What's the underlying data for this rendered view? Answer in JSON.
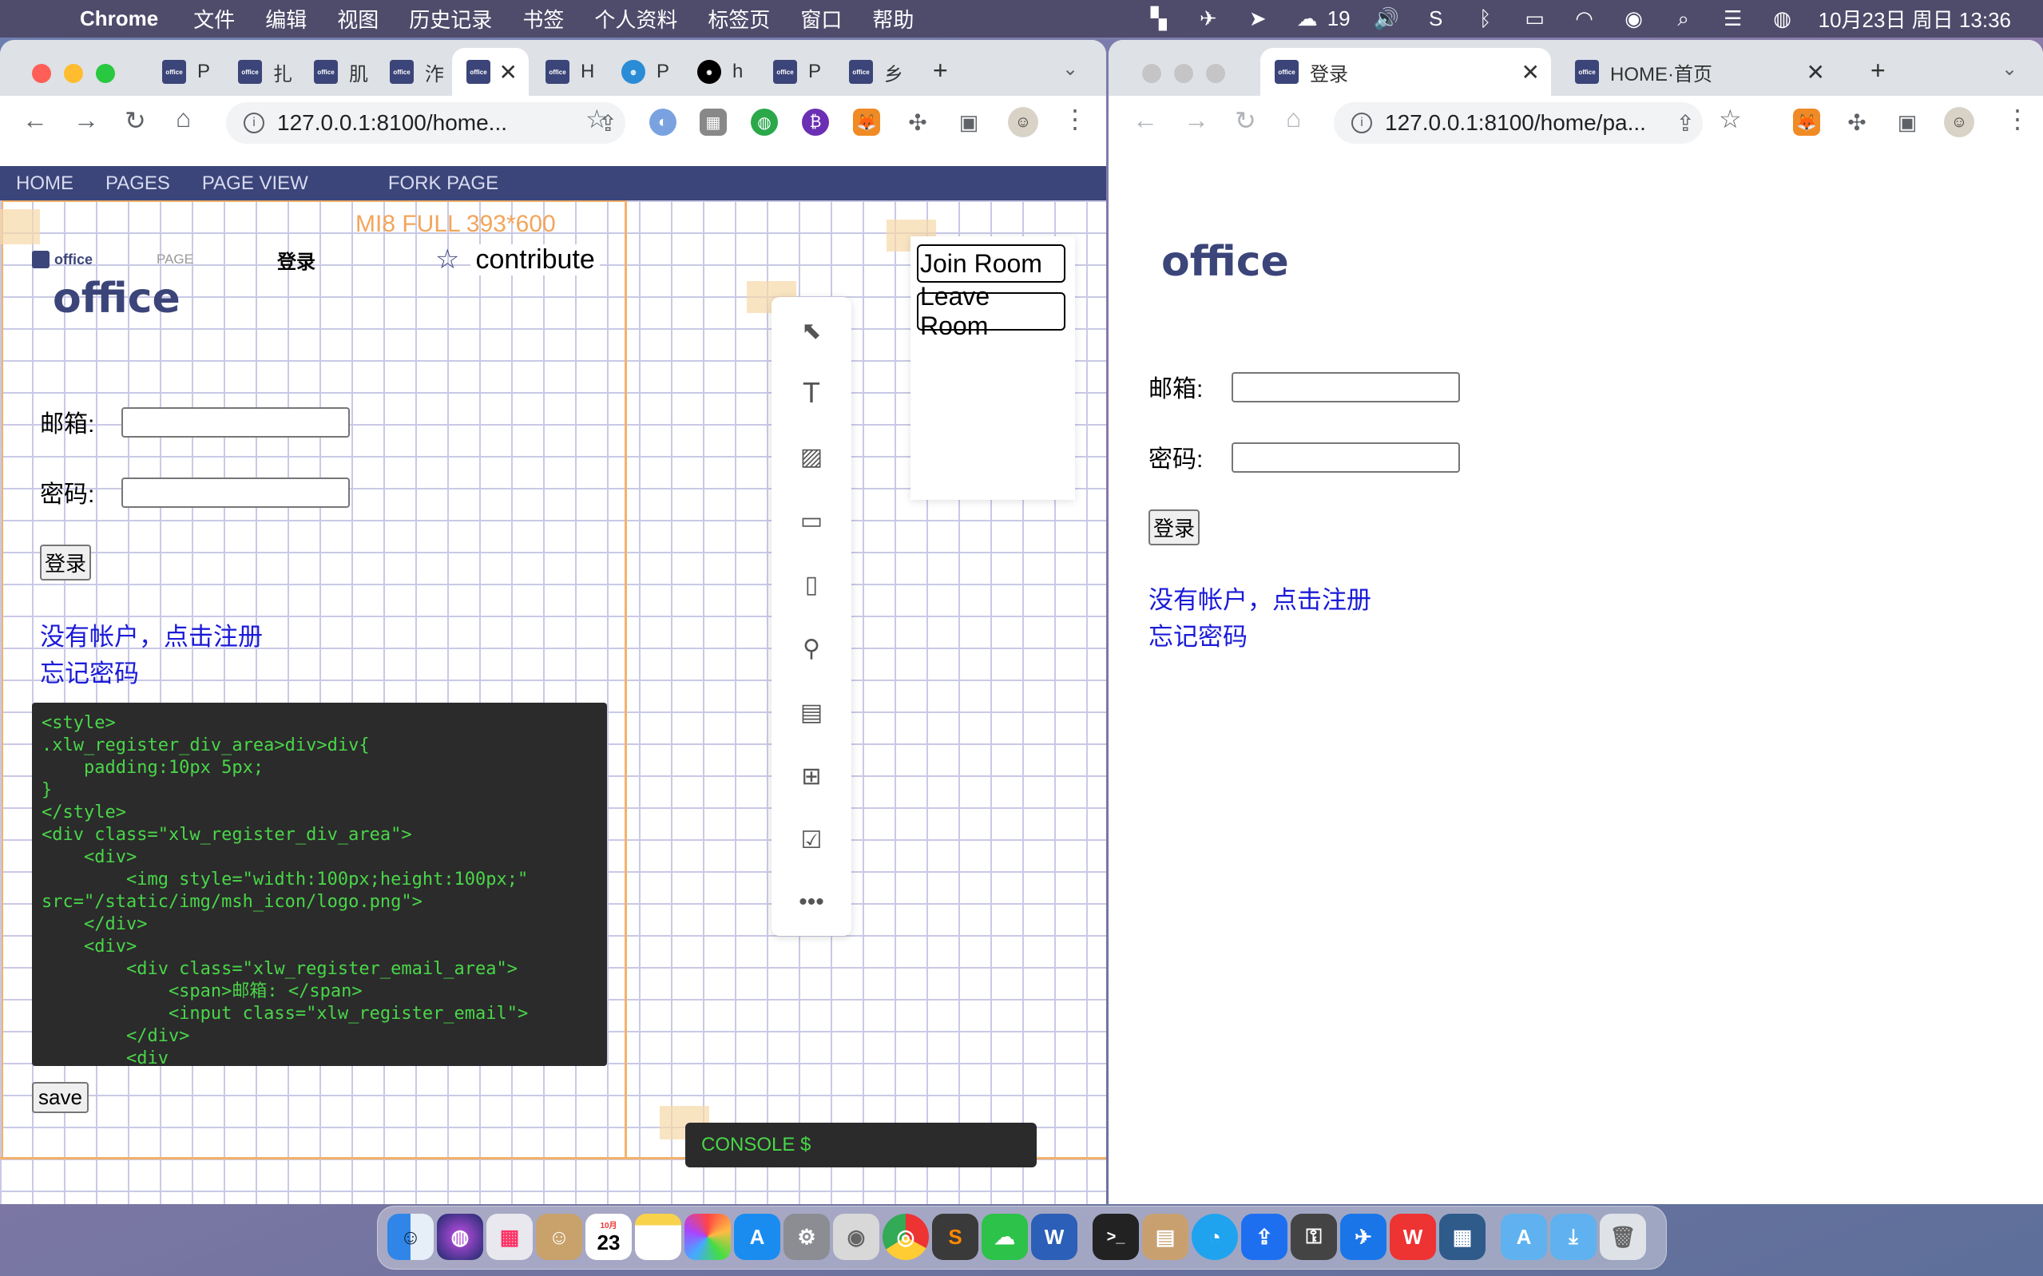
{
  "menubar": {
    "app": "Chrome",
    "items": [
      "文件",
      "编辑",
      "视图",
      "历史记录",
      "书签",
      "个人资料",
      "标签页",
      "窗口",
      "帮助"
    ],
    "wechat_count": "19",
    "datetime": "10月23日 周日  13:36"
  },
  "left_window": {
    "tabs": [
      {
        "letter": "P"
      },
      {
        "letter": "扎"
      },
      {
        "letter": "肌"
      },
      {
        "letter": "泎"
      },
      {
        "letter": "",
        "active": true
      },
      {
        "letter": "H"
      },
      {
        "letter": "P"
      },
      {
        "letter": "h"
      },
      {
        "letter": "P"
      },
      {
        "letter": "乡"
      }
    ],
    "url": "127.0.0.1:8100/home...",
    "appnav": [
      "HOME",
      "PAGES",
      "PAGE VIEW",
      "FORK PAGE"
    ],
    "device_label": "MI8 FULL 393*600",
    "pagebar": {
      "logo": "office",
      "page_label": "PAGE",
      "title": "登录",
      "contribute": "contribute"
    },
    "office_title": "office",
    "email_label": "邮箱:",
    "password_label": "密码:",
    "login_button": "登录",
    "register_link": "没有帐户，点击注册",
    "forgot_link": "忘记密码",
    "code": "<style>\n.xlw_register_div_area>div>div{\n    padding:10px 5px;\n}\n</style>\n<div class=\"xlw_register_div_area\">\n    <div>\n        <img style=\"width:100px;height:100px;\"\nsrc=\"/static/img/msh_icon/logo.png\">\n    </div>\n    <div>\n        <div class=\"xlw_register_email_area\">\n            <span>邮箱: </span>\n            <input class=\"xlw_register_email\">\n        </div>\n        <div",
    "save_button": "save",
    "join_room": "Join Room",
    "leave_room": "Leave Room",
    "console": "CONSOLE $",
    "tools": [
      "select-icon",
      "text-icon",
      "image-add-icon",
      "video-add-icon",
      "file-add-icon",
      "pin-icon",
      "html-file-icon",
      "copy-add-icon",
      "checklist-icon",
      "more-icon"
    ]
  },
  "right_window": {
    "tabs": [
      {
        "title": "登录",
        "active": true
      },
      {
        "title": "HOME·首页"
      }
    ],
    "url": "127.0.0.1:8100/home/pa...",
    "office_title": "office",
    "email_label": "邮箱:",
    "password_label": "密码:",
    "login_button": "登录",
    "register_link": "没有帐户，点击注册",
    "forgot_link": "忘记密码"
  },
  "dock": {
    "calendar_day": "23",
    "calendar_month": "10月"
  }
}
